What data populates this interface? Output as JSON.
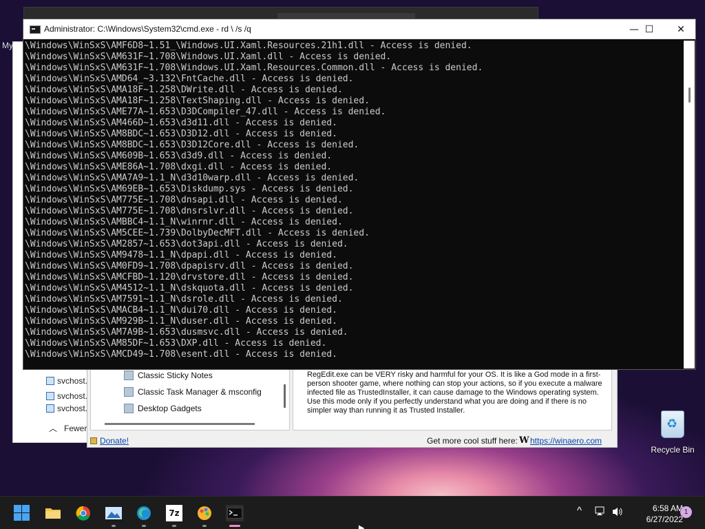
{
  "background_windows": {
    "taskmgr_prefix": "My",
    "processes": [
      "svchost.",
      "svchost.",
      "svchost."
    ],
    "fewer_details": "Fewer"
  },
  "winaero": {
    "tree_items": [
      "Classic Sticky Notes",
      "Classic Task Manager & msconfig",
      "Desktop Gadgets"
    ],
    "description": "RegEdit.exe can be VERY risky and harmful for your OS. It is like a God mode in a first-person shooter game, where nothing can stop your actions, so if you execute a malware infected file as TrustedInstaller, it can cause damage to the Windows operating system. Use this mode only if you perfectly understand what you are doing and if there is no simpler way than running it as Trusted Installer.",
    "donate": "Donate!",
    "more_text": "Get more cool stuff here:",
    "brand_glyph": "W",
    "url": "https://winaero.com"
  },
  "cmd": {
    "title": "Administrator: C:\\Windows\\System32\\cmd.exe - rd  \\ /s /q",
    "minimize": "—",
    "maximize": "☐",
    "close": "✕",
    "lines": [
      "\\Windows\\WinSxS\\AMF6D8~1.51_\\Windows.UI.Xaml.Resources.21h1.dll - Access is denied.",
      "\\Windows\\WinSxS\\AM631F~1.708\\Windows.UI.Xaml.dll - Access is denied.",
      "\\Windows\\WinSxS\\AM631F~1.708\\Windows.UI.Xaml.Resources.Common.dll - Access is denied.",
      "\\Windows\\WinSxS\\AMD64_~3.132\\FntCache.dll - Access is denied.",
      "\\Windows\\WinSxS\\AMA18F~1.258\\DWrite.dll - Access is denied.",
      "\\Windows\\WinSxS\\AMA18F~1.258\\TextShaping.dll - Access is denied.",
      "\\Windows\\WinSxS\\AME77A~1.653\\D3DCompiler_47.dll - Access is denied.",
      "\\Windows\\WinSxS\\AM466D~1.653\\d3d11.dll - Access is denied.",
      "\\Windows\\WinSxS\\AM8BDC~1.653\\D3D12.dll - Access is denied.",
      "\\Windows\\WinSxS\\AM8BDC~1.653\\D3D12Core.dll - Access is denied.",
      "\\Windows\\WinSxS\\AM609B~1.653\\d3d9.dll - Access is denied.",
      "\\Windows\\WinSxS\\AME86A~1.708\\dxgi.dll - Access is denied.",
      "\\Windows\\WinSxS\\AMA7A9~1.1_N\\d3d10warp.dll - Access is denied.",
      "\\Windows\\WinSxS\\AM69EB~1.653\\Diskdump.sys - Access is denied.",
      "\\Windows\\WinSxS\\AM775E~1.708\\dnsapi.dll - Access is denied.",
      "\\Windows\\WinSxS\\AM775E~1.708\\dnsrslvr.dll - Access is denied.",
      "\\Windows\\WinSxS\\AMBBC4~1.1_N\\winrnr.dll - Access is denied.",
      "\\Windows\\WinSxS\\AM5CEE~1.739\\DolbyDecMFT.dll - Access is denied.",
      "\\Windows\\WinSxS\\AM2857~1.653\\dot3api.dll - Access is denied.",
      "\\Windows\\WinSxS\\AM9478~1.1_N\\dpapi.dll - Access is denied.",
      "\\Windows\\WinSxS\\AM0FD9~1.708\\dpapisrv.dll - Access is denied.",
      "\\Windows\\WinSxS\\AMCFBD~1.120\\drvstore.dll - Access is denied.",
      "\\Windows\\WinSxS\\AM4512~1.1_N\\dskquota.dll - Access is denied.",
      "\\Windows\\WinSxS\\AM7591~1.1_N\\dsrole.dll - Access is denied.",
      "\\Windows\\WinSxS\\AMACB4~1.1_N\\dui70.dll - Access is denied.",
      "\\Windows\\WinSxS\\AM929B~1.1_N\\duser.dll - Access is denied.",
      "\\Windows\\WinSxS\\AM7A9B~1.653\\dusmsvc.dll - Access is denied.",
      "\\Windows\\WinSxS\\AM85DF~1.653\\DXP.dll - Access is denied.",
      "\\Windows\\WinSxS\\AMCD49~1.708\\esent.dll - Access is denied."
    ]
  },
  "desktop": {
    "recycle_bin": "Recycle Bin"
  },
  "taskbar": {
    "apps": [
      "start-icon",
      "file-explorer-icon",
      "chrome-icon",
      "photos-icon",
      "edge-icon",
      "7zip-icon",
      "paint-icon",
      "terminal-icon"
    ],
    "seven_zip_label": "7z",
    "tray_chevron": "^",
    "time": "6:58 AM",
    "date": "6/27/2022",
    "notification_count": "1"
  },
  "colors": {
    "console_bg": "#0c0c0c",
    "console_text": "#cccccc",
    "taskbar_bg": "#1c1c1c",
    "accent": "#49a4f4",
    "link": "#0645ad"
  }
}
